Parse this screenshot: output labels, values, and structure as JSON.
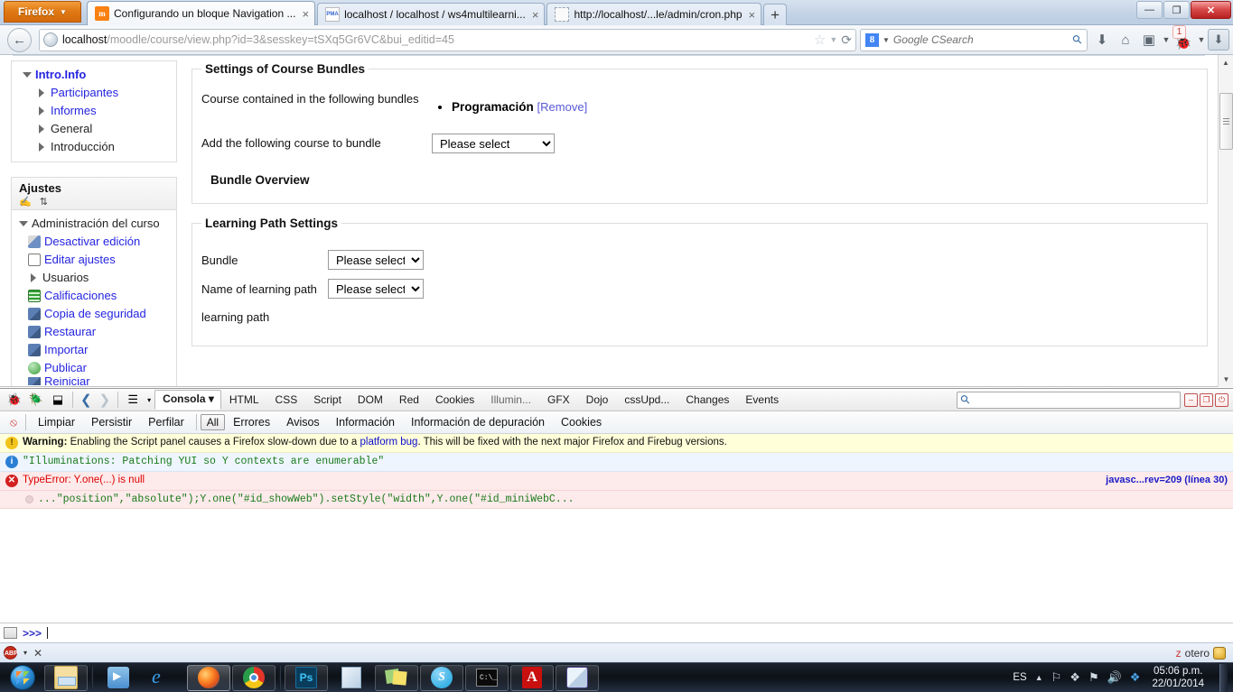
{
  "browser": {
    "app_button": "Firefox",
    "tabs": [
      {
        "title": "Configurando un bloque Navigation ...",
        "favicon": "moodle-icon",
        "active": true,
        "close": "×"
      },
      {
        "title": "localhost / localhost / ws4multilearni...",
        "favicon": "phpmyadmin-icon",
        "active": false,
        "close": "×"
      },
      {
        "title": "http://localhost/...le/admin/cron.php",
        "favicon": "blank-page-icon",
        "active": false,
        "close": "×"
      }
    ],
    "new_tab_label": "+",
    "window_controls": {
      "minimize": "—",
      "maximize": "❐",
      "close": "✕"
    },
    "url_prefix": "localhost",
    "url_rest": "/moodle/course/view.php?id=3&sesskey=tSXq5Gr6VC&bui_editid=45",
    "search_placeholder": "Google CSearch",
    "search_engine": "8",
    "notification_count": "1"
  },
  "sidebar": {
    "nav_block": {
      "items": [
        {
          "label": "Intro.Info",
          "level": 1,
          "arrow": "down",
          "link": true,
          "bold": true
        },
        {
          "label": "Participantes",
          "level": 2,
          "arrow": "right",
          "link": true
        },
        {
          "label": "Informes",
          "level": 2,
          "arrow": "right",
          "link": true
        },
        {
          "label": "General",
          "level": 2,
          "arrow": "right",
          "link": false
        },
        {
          "label": "Introducción",
          "level": 2,
          "arrow": "right",
          "link": false
        }
      ]
    },
    "settings_block": {
      "title": "Ajustes",
      "header_icons": "✍ ⇅",
      "root": "Administración del curso",
      "items": [
        {
          "label": "Desactivar edición",
          "icon": "pencil-icon"
        },
        {
          "label": "Editar ajustes",
          "icon": "doc-icon"
        },
        {
          "label": "Usuarios",
          "icon": "triangle-icon",
          "link": false
        },
        {
          "label": "Calificaciones",
          "icon": "grid-icon"
        },
        {
          "label": "Copia de seguridad",
          "icon": "box-icon"
        },
        {
          "label": "Restaurar",
          "icon": "box-icon"
        },
        {
          "label": "Importar",
          "icon": "box-icon"
        },
        {
          "label": "Publicar",
          "icon": "globe-icon"
        },
        {
          "label": "Reiniciar",
          "icon": "box-icon"
        }
      ]
    }
  },
  "main": {
    "bundles_fieldset": {
      "legend": "Settings of Course Bundles",
      "contained_label": "Course contained in the following bundles",
      "bundle_name": "Programación",
      "remove_label": "[Remove]",
      "add_label": "Add the following course to bundle",
      "add_select_value": "Please select",
      "overview_title": "Bundle Overview"
    },
    "learning_path_fieldset": {
      "legend": "Learning Path Settings",
      "bundle_label": "Bundle",
      "bundle_select_value": "Please select",
      "name_label": "Name of learning path",
      "name_select_value": "Please select",
      "note": "learning path"
    }
  },
  "firebug": {
    "panel_tabs": [
      {
        "label": "Consola",
        "active": true,
        "caret": "▾"
      },
      {
        "label": "HTML"
      },
      {
        "label": "CSS"
      },
      {
        "label": "Script"
      },
      {
        "label": "DOM"
      },
      {
        "label": "Red"
      },
      {
        "label": "Cookies"
      },
      {
        "label": "Illumin...",
        "dim": true
      },
      {
        "label": "GFX"
      },
      {
        "label": "Dojo"
      },
      {
        "label": "cssUpd..."
      },
      {
        "label": "Changes"
      },
      {
        "label": "Events"
      }
    ],
    "filters": [
      {
        "label": "Limpiar"
      },
      {
        "label": "Persistir"
      },
      {
        "label": "Perfilar"
      },
      {
        "label": "All",
        "active": true
      },
      {
        "label": "Errores"
      },
      {
        "label": "Avisos"
      },
      {
        "label": "Información"
      },
      {
        "label": "Información de depuración"
      },
      {
        "label": "Cookies"
      }
    ],
    "search_value": "",
    "window_buttons": [
      "–",
      "❐",
      "⏻"
    ],
    "messages": [
      {
        "type": "warn",
        "prefix": "Warning:",
        "text_before": " Enabling the Script panel causes a Firefox slow-down due to a ",
        "link": "platform bug",
        "text_after": ". This will be fixed with the next major Firefox and Firebug versions."
      },
      {
        "type": "info",
        "text": "\"Illuminations: Patching YUI so Y contexts are enumerable\""
      },
      {
        "type": "error",
        "text": "TypeError: Y.one(...) is null",
        "source_link": "javasc...rev=209 (línea 30)"
      },
      {
        "type": "error-source",
        "text": "...\"position\",\"absolute\");Y.one(\"#id_showWeb\").setStyle(\"width\",Y.one(\"#id_miniWebC..."
      }
    ],
    "command_prompt": ">>>",
    "command_value": ""
  },
  "adblock": {
    "label": "ABP",
    "caret": "▾",
    "close": "✕"
  },
  "zotero": {
    "label_red": "z",
    "label_dark": "otero"
  },
  "taskbar": {
    "pinned": [
      {
        "name": "windows-explorer-icon"
      },
      {
        "name": "windows-media-player-icon"
      },
      {
        "name": "internet-explorer-icon"
      },
      {
        "name": "firefox-icon",
        "active": true
      },
      {
        "name": "chrome-icon"
      },
      {
        "name": "photoshop-icon"
      },
      {
        "name": "notepad-icon"
      },
      {
        "name": "sticky-notes-icon"
      },
      {
        "name": "skype-icon"
      },
      {
        "name": "command-prompt-icon"
      },
      {
        "name": "adobe-reader-icon"
      },
      {
        "name": "virtualbox-icon"
      }
    ],
    "tray": {
      "language": "ES",
      "overflow_caret": "▲",
      "icons": [
        "network-icon",
        "bluetooth-icon",
        "action-center-icon",
        "volume-icon",
        "dropbox-icon"
      ],
      "time": "05:06 p.m.",
      "date": "22/01/2014"
    }
  }
}
